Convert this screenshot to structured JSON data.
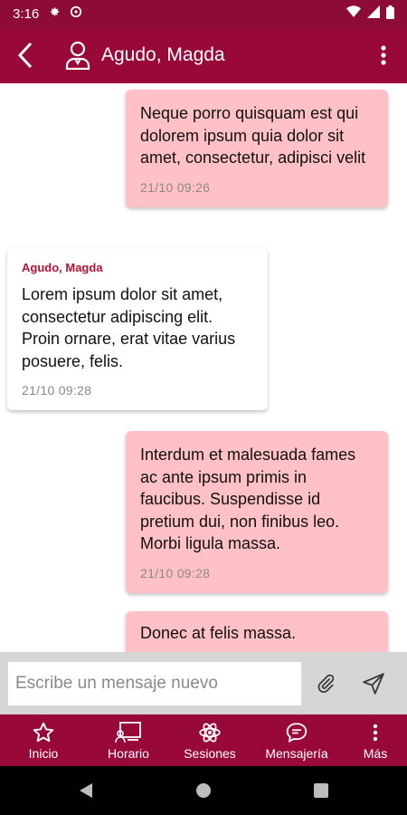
{
  "status_bar": {
    "time": "3:16"
  },
  "header": {
    "title": "Agudo, Magda"
  },
  "messages": [
    {
      "text": "Neque porro quisquam est qui dolorem ipsum quia dolor sit amet, consectetur, adipisci velit",
      "time": "21/10 09:26"
    },
    {
      "sender": "Agudo, Magda",
      "text": "Lorem ipsum dolor sit amet, consectetur adipiscing elit. Proin ornare, erat vitae varius posuere, felis.",
      "time": "21/10 09:28"
    },
    {
      "text": "Interdum et malesuada fames ac ante ipsum primis in faucibus. Suspendisse id pretium dui, non finibus leo. Morbi ligula massa.",
      "time": "21/10 09:28"
    },
    {
      "text": "Donec at felis massa."
    }
  ],
  "composer": {
    "placeholder": "Escribe un mensaje nuevo"
  },
  "nav": [
    {
      "label": "Inicio",
      "icon": "star-icon"
    },
    {
      "label": "Horario",
      "icon": "schedule-icon"
    },
    {
      "label": "Sesiones",
      "icon": "atom-icon"
    },
    {
      "label": "Mensajería",
      "icon": "chat-bubble-icon"
    },
    {
      "label": "Más",
      "icon": "more-vertical-icon"
    }
  ],
  "colors": {
    "primary": "#98093a",
    "outgoing_bubble": "#ffc1c5",
    "sender_name": "#b51233"
  }
}
